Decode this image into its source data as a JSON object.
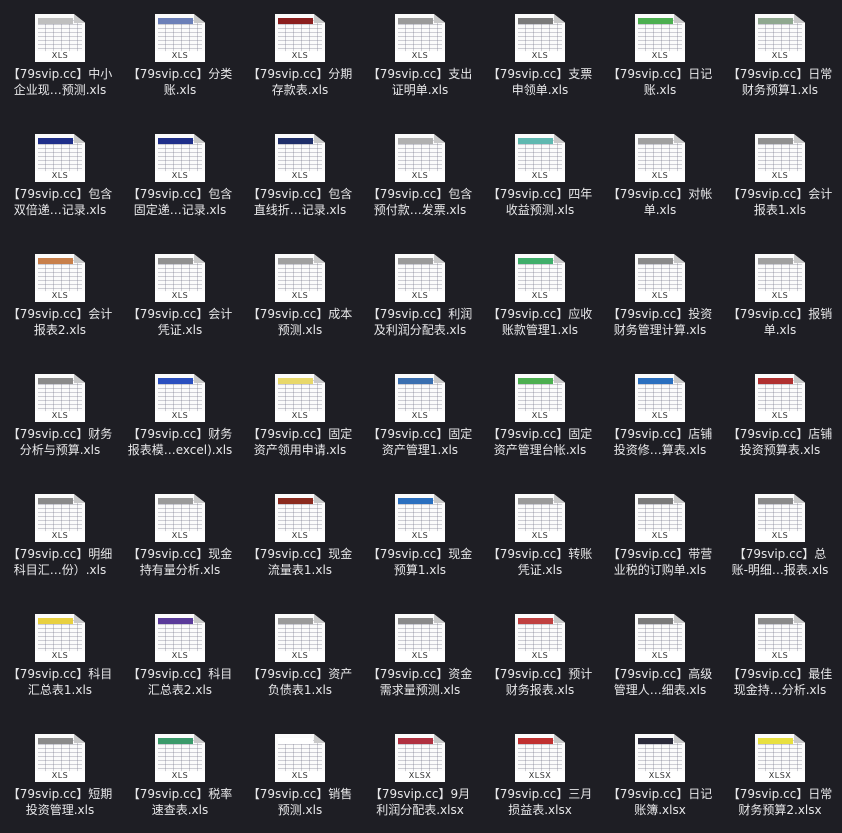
{
  "files": [
    {
      "l1": "【79svip.cc】中小",
      "l2": "企业现…预测.xls",
      "ext": "XLS",
      "accent": "#bfbfbf"
    },
    {
      "l1": "【79svip.cc】分类",
      "l2": "账.xls",
      "ext": "XLS",
      "accent": "#6b7fb8"
    },
    {
      "l1": "【79svip.cc】分期",
      "l2": "存款表.xls",
      "ext": "XLS",
      "accent": "#8b1e1e"
    },
    {
      "l1": "【79svip.cc】支出",
      "l2": "证明单.xls",
      "ext": "XLS",
      "accent": "#9a9a9a"
    },
    {
      "l1": "【79svip.cc】支票",
      "l2": "申领单.xls",
      "ext": "XLS",
      "accent": "#7a7a7a"
    },
    {
      "l1": "【79svip.cc】日记",
      "l2": "账.xls",
      "ext": "XLS",
      "accent": "#4caf50"
    },
    {
      "l1": "【79svip.cc】日常",
      "l2": "财务预算1.xls",
      "ext": "XLS",
      "accent": "#8fa88f"
    },
    {
      "l1": "【79svip.cc】包含",
      "l2": "双倍递…记录.xls",
      "ext": "XLS",
      "accent": "#1f2f8a"
    },
    {
      "l1": "【79svip.cc】包含",
      "l2": "固定递…记录.xls",
      "ext": "XLS",
      "accent": "#1f2f8a"
    },
    {
      "l1": "【79svip.cc】包含",
      "l2": "直线折…记录.xls",
      "ext": "XLS",
      "accent": "#1f2f6a"
    },
    {
      "l1": "【79svip.cc】包含",
      "l2": "预付款…发票.xls",
      "ext": "XLS",
      "accent": "#b0b0b0"
    },
    {
      "l1": "【79svip.cc】四年",
      "l2": "收益预测.xls",
      "ext": "XLS",
      "accent": "#5fb8b0"
    },
    {
      "l1": "【79svip.cc】对帐",
      "l2": "单.xls",
      "ext": "XLS",
      "accent": "#a0a0a0"
    },
    {
      "l1": "【79svip.cc】会计",
      "l2": "报表1.xls",
      "ext": "XLS",
      "accent": "#909090"
    },
    {
      "l1": "【79svip.cc】会计",
      "l2": "报表2.xls",
      "ext": "XLS",
      "accent": "#c87f4a"
    },
    {
      "l1": "【79svip.cc】会计",
      "l2": "凭证.xls",
      "ext": "XLS",
      "accent": "#909090"
    },
    {
      "l1": "【79svip.cc】成本",
      "l2": "预测.xls",
      "ext": "XLS",
      "accent": "#a0a0a0"
    },
    {
      "l1": "【79svip.cc】利润",
      "l2": "及利润分配表.xls",
      "ext": "XLS",
      "accent": "#9a9a9a"
    },
    {
      "l1": "【79svip.cc】应收",
      "l2": "账款管理1.xls",
      "ext": "XLS",
      "accent": "#3fae6a"
    },
    {
      "l1": "【79svip.cc】投资",
      "l2": "财务管理计算.xls",
      "ext": "XLS",
      "accent": "#8a8a8a"
    },
    {
      "l1": "【79svip.cc】报销",
      "l2": "单.xls",
      "ext": "XLS",
      "accent": "#a0a0a0"
    },
    {
      "l1": "【79svip.cc】财务",
      "l2": "分析与预算.xls",
      "ext": "XLS",
      "accent": "#8a8a8a"
    },
    {
      "l1": "【79svip.cc】财务",
      "l2": "报表模…excel).xls",
      "ext": "XLS",
      "accent": "#2a4fbf"
    },
    {
      "l1": "【79svip.cc】固定",
      "l2": "资产领用申请.xls",
      "ext": "XLS",
      "accent": "#e8d86a"
    },
    {
      "l1": "【79svip.cc】固定",
      "l2": "资产管理1.xls",
      "ext": "XLS",
      "accent": "#3a6fb0"
    },
    {
      "l1": "【79svip.cc】固定",
      "l2": "资产管理台帐.xls",
      "ext": "XLS",
      "accent": "#4caf50"
    },
    {
      "l1": "【79svip.cc】店铺",
      "l2": "投资修…算表.xls",
      "ext": "XLS",
      "accent": "#2a6fbf"
    },
    {
      "l1": "【79svip.cc】店铺",
      "l2": "投资预算表.xls",
      "ext": "XLS",
      "accent": "#b03030"
    },
    {
      "l1": "【79svip.cc】明细",
      "l2": "科目汇…份）.xls",
      "ext": "XLS",
      "accent": "#8a8a8a"
    },
    {
      "l1": "【79svip.cc】现金",
      "l2": "持有量分析.xls",
      "ext": "XLS",
      "accent": "#9a9a9a"
    },
    {
      "l1": "【79svip.cc】现金",
      "l2": "流量表1.xls",
      "ext": "XLS",
      "accent": "#8b2a1e"
    },
    {
      "l1": "【79svip.cc】现金",
      "l2": "预算1.xls",
      "ext": "XLS",
      "accent": "#2a6fbf"
    },
    {
      "l1": "【79svip.cc】转账",
      "l2": "凭证.xls",
      "ext": "XLS",
      "accent": "#9a9a9a"
    },
    {
      "l1": "【79svip.cc】带营",
      "l2": "业税的订购单.xls",
      "ext": "XLS",
      "accent": "#7a7a7a"
    },
    {
      "l1": "【79svip.cc】总",
      "l2": "账-明细…报表.xls",
      "ext": "XLS",
      "accent": "#8a8a8a"
    },
    {
      "l1": "【79svip.cc】科目",
      "l2": "汇总表1.xls",
      "ext": "XLS",
      "accent": "#e8d040"
    },
    {
      "l1": "【79svip.cc】科目",
      "l2": "汇总表2.xls",
      "ext": "XLS",
      "accent": "#5a3a9a"
    },
    {
      "l1": "【79svip.cc】资产",
      "l2": "负债表1.xls",
      "ext": "XLS",
      "accent": "#9a9a9a"
    },
    {
      "l1": "【79svip.cc】资金",
      "l2": "需求量预测.xls",
      "ext": "XLS",
      "accent": "#8a8a8a"
    },
    {
      "l1": "【79svip.cc】预计",
      "l2": "财务报表.xls",
      "ext": "XLS",
      "accent": "#c04040"
    },
    {
      "l1": "【79svip.cc】高级",
      "l2": "管理人…细表.xls",
      "ext": "XLS",
      "accent": "#7a7a7a"
    },
    {
      "l1": "【79svip.cc】最佳",
      "l2": "现金持…分析.xls",
      "ext": "XLS",
      "accent": "#8a8a8a"
    },
    {
      "l1": "【79svip.cc】短期",
      "l2": "投资管理.xls",
      "ext": "XLS",
      "accent": "#8a8a8a"
    },
    {
      "l1": "【79svip.cc】税率",
      "l2": "速查表.xls",
      "ext": "XLS",
      "accent": "#3a9a6a"
    },
    {
      "l1": "【79svip.cc】销售",
      "l2": "预测.xls",
      "ext": "XLS",
      "accent": "#ffffff"
    },
    {
      "l1": "【79svip.cc】9月",
      "l2": "利润分配表.xlsx",
      "ext": "XLSX",
      "accent": "#b03040"
    },
    {
      "l1": "【79svip.cc】三月",
      "l2": "损益表.xlsx",
      "ext": "XLSX",
      "accent": "#c03030"
    },
    {
      "l1": "【79svip.cc】日记",
      "l2": "账簿.xlsx",
      "ext": "XLSX",
      "accent": "#2a2a3a"
    },
    {
      "l1": "【79svip.cc】日常",
      "l2": "财务预算2.xlsx",
      "ext": "XLSX",
      "accent": "#e8e040"
    }
  ]
}
